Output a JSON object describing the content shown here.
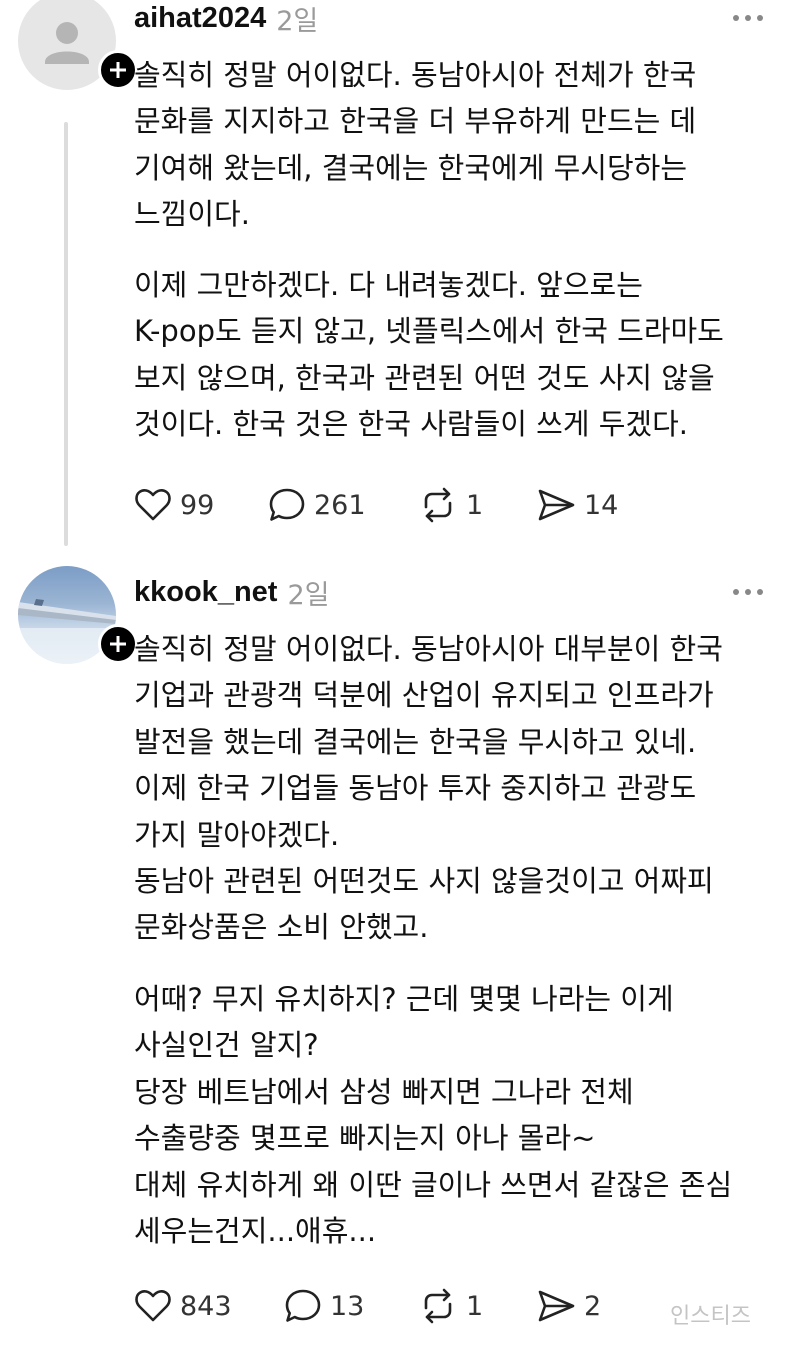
{
  "posts": [
    {
      "username": "aihat2024",
      "timestamp": "2일",
      "paragraphs": [
        "솔직히 정말 어이없다. 동남아시아 전체가 한국\n문화를 지지하고 한국을 더 부유하게 만드는 데\n기여해 왔는데, 결국에는 한국에게 무시당하는\n느낌이다.",
        "이제 그만하겠다. 다 내려놓겠다. 앞으로는\nK-pop도 듣지 않고, 넷플릭스에서 한국 드라마도\n보지 않으며, 한국과 관련된 어떤 것도 사지 않을\n것이다. 한국 것은 한국 사람들이 쓰게 두겠다."
      ],
      "likes": "99",
      "replies": "261",
      "reposts": "1",
      "shares": "14"
    },
    {
      "username": "kkook_net",
      "timestamp": "2일",
      "paragraphs": [
        "솔직히 정말 어이없다. 동남아시아 대부분이 한국\n기업과 관광객 덕분에 산업이 유지되고 인프라가\n발전을 했는데 결국에는 한국을 무시하고 있네.\n이제 한국 기업들 동남아 투자 중지하고 관광도\n가지 말아야겠다.\n동남아 관련된 어떤것도 사지 않을것이고 어짜피\n문화상품은 소비 안했고.",
        "어때? 무지 유치하지? 근데 몇몇 나라는 이게\n사실인건 알지?\n당장 베트남에서 삼성 빠지면 그나라 전체\n수출량중 몇프로 빠지는지 아나 몰라~\n대체 유치하게 왜 이딴 글이나 쓰면서 같잖은 존심\n세우는건지...애휴..."
      ],
      "likes": "843",
      "replies": "13",
      "reposts": "1",
      "shares": "2"
    }
  ],
  "watermark": "인스티즈"
}
